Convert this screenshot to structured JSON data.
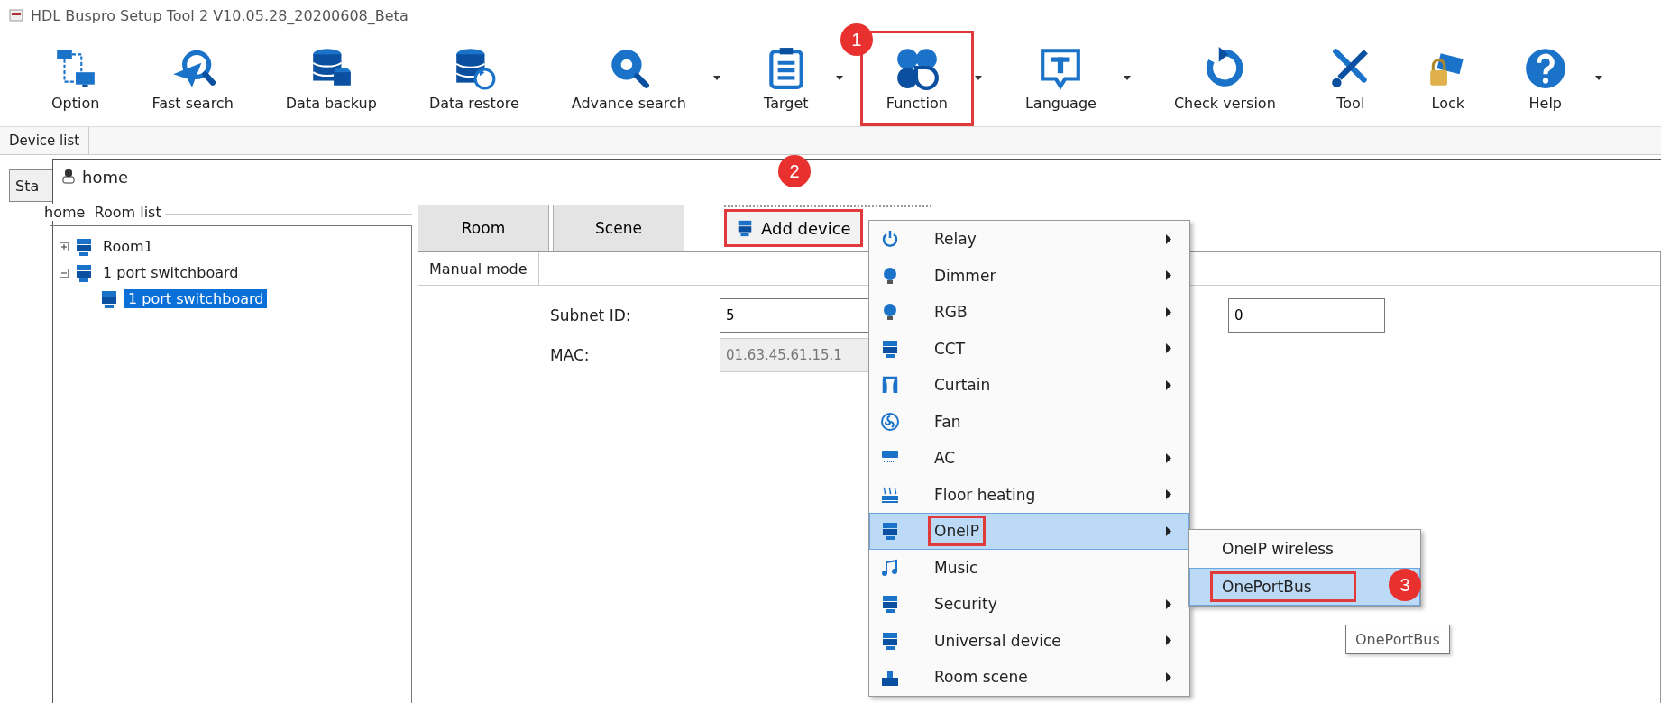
{
  "window": {
    "title": "HDL Buspro Setup Tool 2 V10.05.28_20200608_Beta"
  },
  "toolbar": [
    {
      "label": "Option",
      "dropdown": false,
      "outlined": false
    },
    {
      "label": "Fast search",
      "dropdown": false,
      "outlined": false
    },
    {
      "label": "Data backup",
      "dropdown": false,
      "outlined": false
    },
    {
      "label": "Data restore",
      "dropdown": false,
      "outlined": false
    },
    {
      "label": "Advance search",
      "dropdown": true,
      "outlined": false
    },
    {
      "label": "Target",
      "dropdown": true,
      "outlined": false
    },
    {
      "label": "Function",
      "dropdown": true,
      "outlined": true,
      "callout": "1"
    },
    {
      "label": "Language",
      "dropdown": true,
      "outlined": false
    },
    {
      "label": "Check version",
      "dropdown": false,
      "outlined": false
    },
    {
      "label": "Tool",
      "dropdown": false,
      "outlined": false
    },
    {
      "label": "Lock",
      "dropdown": false,
      "outlined": false
    },
    {
      "label": "Help",
      "dropdown": true,
      "outlined": false
    }
  ],
  "tabs": [
    {
      "label": "Device list"
    }
  ],
  "side_tab": {
    "label": "Sta"
  },
  "home_window": {
    "title": "home",
    "room_list": {
      "title": "home  Room list",
      "tree": [
        {
          "label": "Room1",
          "expanded": false,
          "selected": false
        },
        {
          "label": "1 port switchboard",
          "expanded": true,
          "selected": false,
          "children": [
            {
              "label": "1 port switchboard",
              "selected": true
            }
          ]
        }
      ]
    },
    "view_tabs": [
      {
        "label": "Room",
        "selected": false
      },
      {
        "label": "Scene",
        "selected": false
      }
    ],
    "add_device": {
      "label": "Add device",
      "outlined": true,
      "callout": "2"
    },
    "mode_tabs": [
      {
        "label": "Manual mode"
      }
    ],
    "fields": [
      {
        "label": "Subnet ID:",
        "value": "5",
        "disabled": false
      },
      {
        "label": "MAC:",
        "value": "01.63.45.61.15.1",
        "disabled": true
      }
    ],
    "device_field": {
      "value": "0"
    }
  },
  "menu": {
    "items": [
      {
        "label": "Relay",
        "submenu": true,
        "selected": false,
        "outlined": false
      },
      {
        "label": "Dimmer",
        "submenu": true,
        "selected": false,
        "outlined": false
      },
      {
        "label": "RGB",
        "submenu": true,
        "selected": false,
        "outlined": false
      },
      {
        "label": "CCT",
        "submenu": true,
        "selected": false,
        "outlined": false
      },
      {
        "label": "Curtain",
        "submenu": true,
        "selected": false,
        "outlined": false
      },
      {
        "label": "Fan",
        "submenu": false,
        "selected": false,
        "outlined": false
      },
      {
        "label": "AC",
        "submenu": true,
        "selected": false,
        "outlined": false
      },
      {
        "label": "Floor heating",
        "submenu": true,
        "selected": false,
        "outlined": false
      },
      {
        "label": "OneIP",
        "submenu": true,
        "selected": true,
        "outlined": true
      },
      {
        "label": "Music",
        "submenu": false,
        "selected": false,
        "outlined": false
      },
      {
        "label": "Security",
        "submenu": true,
        "selected": false,
        "outlined": false
      },
      {
        "label": "Universal device",
        "submenu": true,
        "selected": false,
        "outlined": false
      },
      {
        "label": "Room scene",
        "submenu": true,
        "selected": false,
        "outlined": false
      }
    ]
  },
  "submenu": {
    "items": [
      {
        "label": "OneIP wireless",
        "selected": false,
        "outlined": false
      },
      {
        "label": "OnePortBus",
        "selected": true,
        "outlined": true,
        "callout": "3"
      }
    ]
  },
  "tooltip": {
    "text": "OnePortBus"
  }
}
